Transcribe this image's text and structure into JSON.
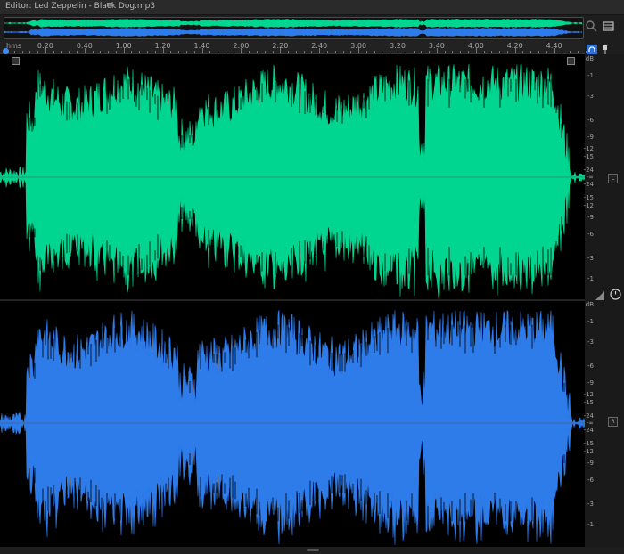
{
  "window": {
    "title": "Editor: Led Zeppelin - Black Dog.mp3",
    "menu_icon": "hamburger-icon"
  },
  "ruler": {
    "unit_label": "hms",
    "labels": [
      "0:20",
      "0:40",
      "1:00",
      "1:20",
      "1:40",
      "2:00",
      "2:20",
      "2:40",
      "3:00",
      "3:20",
      "3:40",
      "4:00",
      "4:20",
      "4:40"
    ]
  },
  "channels": [
    {
      "name": "L",
      "color": "#00d68f",
      "db_labels": [
        "dB",
        "-1",
        "-3",
        "-6",
        "-9",
        "-12",
        "-15",
        "-24",
        "-∞",
        "-24",
        "-15",
        "-12",
        "-9",
        "-6",
        "-3",
        "-1"
      ]
    },
    {
      "name": "R",
      "color": "#2e7bea",
      "db_labels": [
        "dB",
        "-1",
        "-3",
        "-6",
        "-9",
        "-12",
        "-15",
        "-24",
        "-∞",
        "-24",
        "-15",
        "-12",
        "-9",
        "-6",
        "-3",
        "-1"
      ]
    }
  ],
  "icons": {
    "zoom_in": "zoom-icon",
    "panels": "panel-toggle-icon",
    "headphones": "headphones-icon",
    "pin": "pin-icon",
    "volume": "volume-icon",
    "clock": "clock-icon"
  }
}
